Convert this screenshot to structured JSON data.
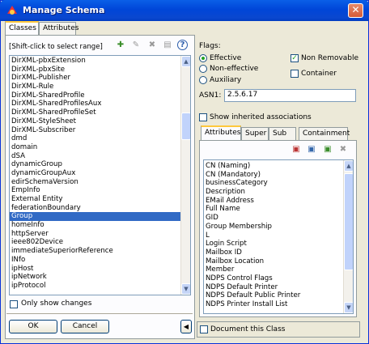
{
  "window": {
    "title": "Manage Schema",
    "close_glyph": "✕"
  },
  "tabs": [
    {
      "label": "Classes"
    },
    {
      "label": "Attributes"
    }
  ],
  "left": {
    "hint": "[Shift-click to select range]",
    "toolbar": [
      {
        "icon": "add-icon"
      },
      {
        "icon": "edit-icon"
      },
      {
        "icon": "delete-icon"
      },
      {
        "icon": "properties-icon"
      },
      {
        "icon": "help-icon"
      }
    ],
    "items": [
      "DirXML-pbxExtension",
      "DirXML-pbxSite",
      "DirXML-Publisher",
      "DirXML-Rule",
      "DirXML-SharedProfile",
      "DirXML-SharedProfilesAux",
      "DirXML-SharedProfileSet",
      "DirXML-StyleSheet",
      "DirXML-Subscriber",
      "dmd",
      "domain",
      "dSA",
      "dynamicGroup",
      "dynamicGroupAux",
      "edirSchemaVersion",
      "EmpInfo",
      "External Entity",
      "federationBoundary",
      "Group",
      "homeInfo",
      "httpServer",
      "ieee802Device",
      "immediateSuperiorReference",
      "INfo",
      "ipHost",
      "ipNetwork",
      "ipProtocol"
    ],
    "selected_index": 18,
    "only_show_changes": "Only show changes",
    "ok": "OK",
    "cancel": "Cancel",
    "toggle_glyph": "◀"
  },
  "right": {
    "flags_label": "Flags:",
    "radios": [
      {
        "label": "Effective",
        "checked": true
      },
      {
        "label": "Non-effective",
        "checked": false
      },
      {
        "label": "Auxiliary",
        "checked": false
      }
    ],
    "checks": [
      {
        "label": "Non Removable",
        "checked": true
      },
      {
        "label": "Container",
        "checked": false
      }
    ],
    "asn1_label": "ASN1:",
    "asn1_value": "2.5.6.17",
    "show_inherited": "Show inherited associations",
    "subtabs": [
      {
        "label": "Attributes"
      },
      {
        "label": "Super"
      },
      {
        "label": "Sub"
      },
      {
        "label": "Containment"
      }
    ],
    "attrs": [
      "CN (Naming)",
      "CN (Mandatory)",
      "businessCategory",
      "Description",
      "EMail Address",
      "Full Name",
      "GID",
      "Group Membership",
      "L",
      "Login Script",
      "Mailbox ID",
      "Mailbox Location",
      "Member",
      "NDPS Control Flags",
      "NDPS Default Printer",
      "NDPS Default Public Printer",
      "NDPS Printer Install List"
    ],
    "document_class": "Document this Class"
  }
}
